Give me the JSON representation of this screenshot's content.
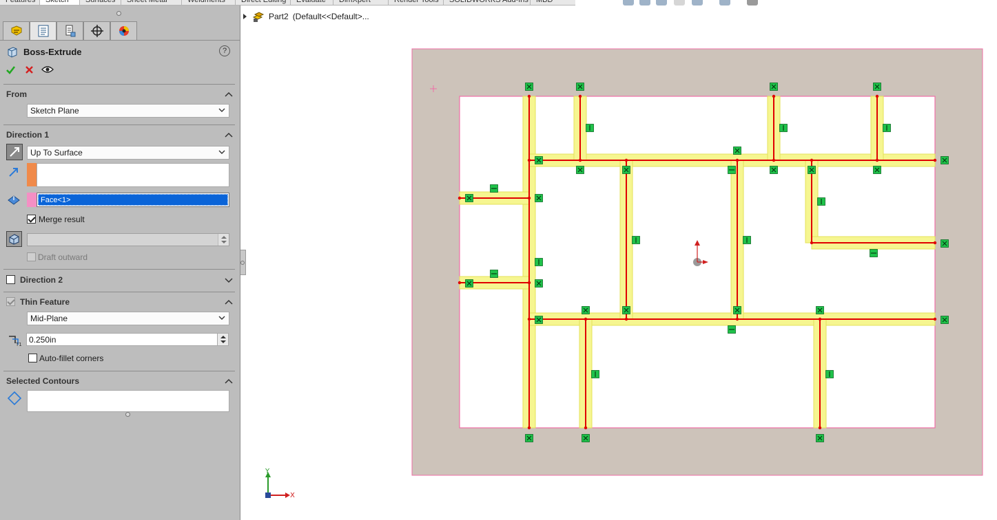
{
  "command_tabs": [
    "Features",
    "Sketch",
    "Surfaces",
    "Sheet Metal",
    "Weldments",
    "Direct Editing",
    "Evaluate",
    "DimXpert",
    "Render Tools",
    "SOLIDWORKS Add-Ins",
    "MBD"
  ],
  "manager_tabs": [
    "feature-manager-icon",
    "property-manager-icon",
    "configuration-manager-icon",
    "dimxpert-manager-icon",
    "display-manager-icon"
  ],
  "feature": {
    "title": "Boss-Extrude",
    "help": "?"
  },
  "from": {
    "heading": "From",
    "value": "Sketch Plane"
  },
  "direction1": {
    "heading": "Direction 1",
    "end_condition": "Up To Surface",
    "direction_field": "",
    "surface": "Face<1>",
    "merge_label": "Merge result",
    "merge_checked": true,
    "draft_value": "",
    "draft_outward_label": "Draft outward"
  },
  "direction2": {
    "heading": "Direction 2"
  },
  "thin_feature": {
    "heading": "Thin Feature",
    "type": "Mid-Plane",
    "thickness": "0.250in",
    "auto_fillet_label": "Auto-fillet corners"
  },
  "selected_contours": {
    "heading": "Selected Contours"
  },
  "tree": {
    "part": "Part2",
    "config": "(Default<<Default>..."
  },
  "triad": {
    "x": "X",
    "y": "Y"
  },
  "colors": {
    "accent_green": "#22a822",
    "cancel_red": "#d42020",
    "selection_blue": "#0a64d8",
    "sketch_red": "#e00000",
    "preview_yellow": "#f6f690",
    "plane_tan": "#cdc3ba",
    "plane_border": "#ef6fa6",
    "relation_green": "#1fc24a"
  }
}
